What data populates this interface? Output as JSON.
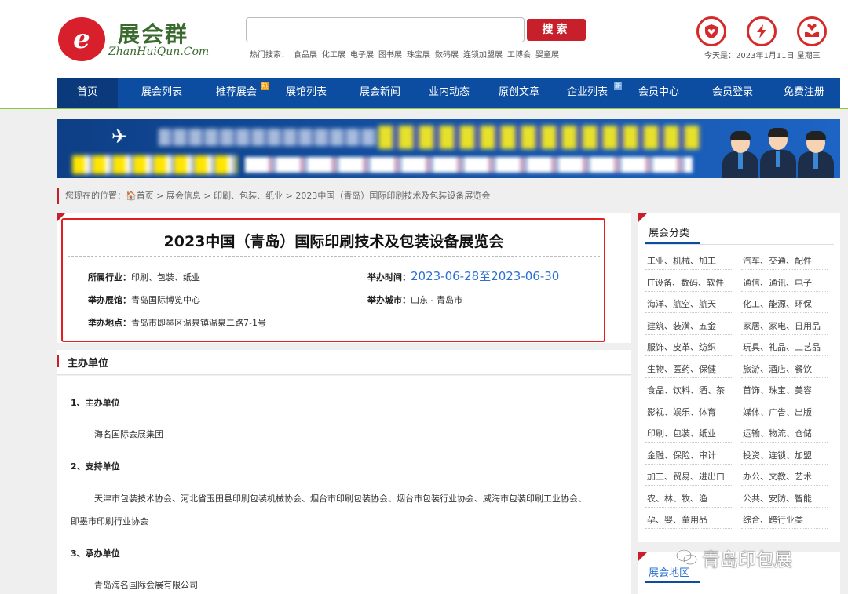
{
  "header": {
    "logo_cn": "展会群",
    "logo_en": "ZhanHuiQun.Com",
    "search_placeholder": "",
    "search_button": "搜索",
    "hot_search_label": "热门搜索：",
    "hot_search": [
      "食品展",
      "化工展",
      "电子展",
      "图书展",
      "珠宝展",
      "数码展",
      "连锁加盟展",
      "工博会",
      "婴童展"
    ],
    "date_text": "今天是：2023年1月11日 星期三",
    "top_icons": [
      "shield-heart-icon",
      "lightning-icon",
      "heart-hands-icon"
    ]
  },
  "nav": {
    "items": [
      {
        "label": "首页",
        "badge": ""
      },
      {
        "label": "展会列表",
        "badge": ""
      },
      {
        "label": "推荐展会",
        "badge": "热"
      },
      {
        "label": "展馆列表",
        "badge": ""
      },
      {
        "label": "展会新闻",
        "badge": ""
      },
      {
        "label": "业内动态",
        "badge": ""
      },
      {
        "label": "原创文章",
        "badge": ""
      },
      {
        "label": "企业列表",
        "badge": "新"
      },
      {
        "label": "会员中心",
        "badge": ""
      },
      {
        "label": "会员登录",
        "badge": ""
      },
      {
        "label": "免费注册",
        "badge": ""
      }
    ]
  },
  "breadcrumb": {
    "text": "您现在的位置：",
    "home": "首页",
    "path": " > 展会信息 > 印刷、包装、纸业 > 2023中国（青岛）国际印刷技术及包装设备展览会"
  },
  "expo": {
    "title": "2023中国（青岛）国际印刷技术及包装设备展览会",
    "industry_label": "所属行业：",
    "industry": "印刷、包装、纸业",
    "time_label": "举办时间：",
    "time": "2023-06-28至2023-06-30",
    "venue_label": "举办展馆：",
    "venue": "青岛国际博览中心",
    "city_label": "举办城市：",
    "city": "山东 - 青岛市",
    "address_label": "举办地点：",
    "address": "青岛市即墨区温泉镇温泉二路7-1号"
  },
  "organizers": {
    "heading": "主办单位",
    "s1_title": "1、主办单位",
    "s1_body": "海名国际会展集团",
    "s2_title": "2、支持单位",
    "s2_body_line1": "天津市包装技术协会、河北省玉田县印刷包装机械协会、烟台市印刷包装协会、烟台市包装行业协会、威海市包装印刷工业协会、",
    "s2_body_line2": "即墨市印刷行业协会",
    "s3_title": "3、承办单位",
    "s3_body": "青岛海名国际会展有限公司"
  },
  "sidebar": {
    "title": "展会分类",
    "categories": [
      [
        "工业、机械、加工",
        "汽车、交通、配件"
      ],
      [
        "IT设备、数码、软件",
        "通信、通讯、电子"
      ],
      [
        "海洋、航空、航天",
        "化工、能源、环保"
      ],
      [
        "建筑、装潢、五金",
        "家居、家电、日用品"
      ],
      [
        "服饰、皮革、纺织",
        "玩具、礼品、工艺品"
      ],
      [
        "生物、医药、保健",
        "旅游、酒店、餐饮"
      ],
      [
        "食品、饮料、酒、茶",
        "首饰、珠宝、美容"
      ],
      [
        "影视、娱乐、体育",
        "媒体、广告、出版"
      ],
      [
        "印刷、包装、纸业",
        "运输、物流、仓储"
      ],
      [
        "金融、保险、审计",
        "投资、连锁、加盟"
      ],
      [
        "加工、贸易、进出口",
        "办公、文教、艺术"
      ],
      [
        "农、林、牧、渔",
        "公共、安防、智能"
      ],
      [
        "孕、婴、童用品",
        "综合、跨行业类"
      ]
    ],
    "region_title": "展会地区"
  },
  "watermark": "青岛印包展",
  "colors": {
    "brand_red": "#c8202a",
    "nav_blue": "#0c4da2",
    "link_blue": "#2a6fd1",
    "green_line": "#8cc63f"
  }
}
